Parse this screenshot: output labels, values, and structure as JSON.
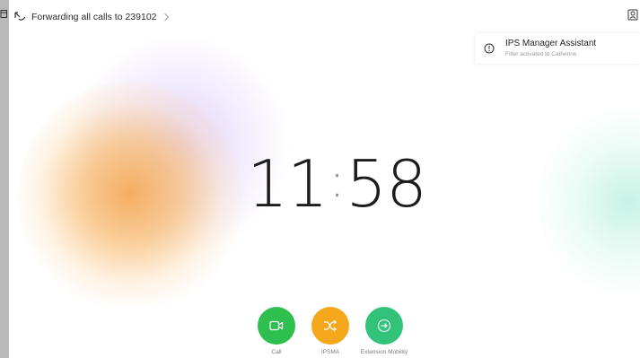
{
  "forwarding": {
    "text": "Forwarding all calls to 239102"
  },
  "notification": {
    "title": "IPS Manager Assistant",
    "subtitle": "Filter activated to Catherine"
  },
  "clock": {
    "hours": "11",
    "separator": ":",
    "minutes": "58"
  },
  "actions": [
    {
      "label": "Call",
      "icon": "video-camera-icon",
      "color": "#2fbf4f"
    },
    {
      "label": "IPSMA",
      "icon": "shuffle-icon",
      "color": "#f5a81c"
    },
    {
      "label": "Extension Mobility",
      "icon": "sign-in-icon",
      "color": "#33c27a"
    }
  ],
  "colors": {
    "call_green": "#2fbf4f",
    "ipsma_orange": "#f5a81c",
    "mobility_green": "#33c27a"
  }
}
